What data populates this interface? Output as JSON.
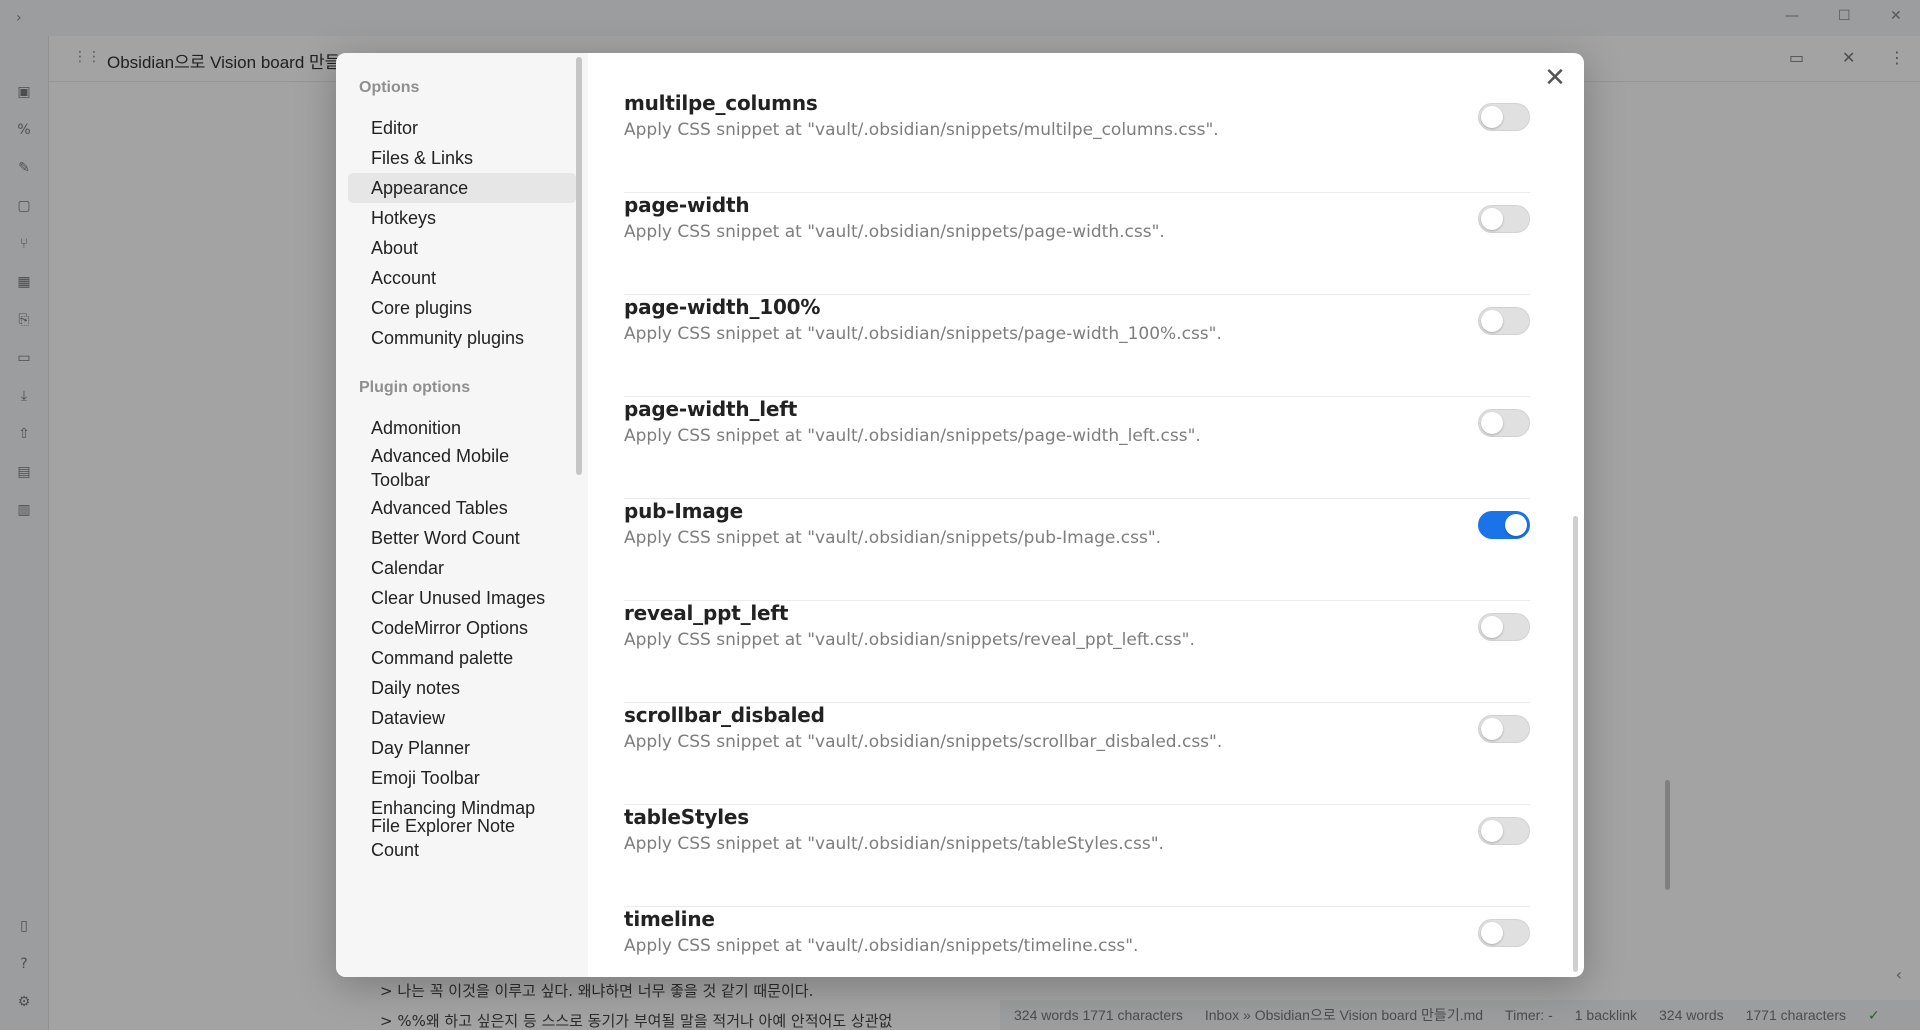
{
  "app": {
    "tab_title": "Obsidian으로 Vision board 만들기",
    "window_controls": [
      "minimize-icon",
      "maximize-icon",
      "close-icon"
    ],
    "editor_lines": [
      ">  나는 꼭 이것을 이루고 싶다. 왜냐하면 너무 좋을 것 같기 때문이다.",
      ">  %%왜 하고 싶은지 등 스스로 동기가 부여될 말을 적거나 아예 안적어도 상관없"
    ],
    "status": {
      "word_count": "324 words 1771 characters",
      "breadcrumb": "Inbox » Obsidian으로 Vision board 만들기.md",
      "timer": "Timer: -",
      "backlinks": "1 backlink",
      "words": "324 words",
      "characters": "1771 characters"
    }
  },
  "settings": {
    "close_label": "✕",
    "options_title": "Options",
    "options_items": [
      {
        "label": "Editor",
        "active": false
      },
      {
        "label": "Files & Links",
        "active": false
      },
      {
        "label": "Appearance",
        "active": true
      },
      {
        "label": "Hotkeys",
        "active": false
      },
      {
        "label": "About",
        "active": false
      },
      {
        "label": "Account",
        "active": false
      },
      {
        "label": "Core plugins",
        "active": false
      },
      {
        "label": "Community plugins",
        "active": false
      }
    ],
    "plugin_title": "Plugin options",
    "plugin_items": [
      "Admonition",
      "Advanced Mobile Toolbar",
      "Advanced Tables",
      "Better Word Count",
      "Calendar",
      "Clear Unused Images",
      "CodeMirror Options",
      "Command palette",
      "Daily notes",
      "Dataview",
      "Day Planner",
      "Emoji Toolbar",
      "Enhancing Mindmap",
      "File Explorer Note Count"
    ],
    "snippets": [
      {
        "name": "multilpe_columns",
        "desc": "Apply CSS snippet at \"vault/.obsidian/snippets/multilpe_columns.css\".",
        "enabled": false
      },
      {
        "name": "page-width",
        "desc": "Apply CSS snippet at \"vault/.obsidian/snippets/page-width.css\".",
        "enabled": false
      },
      {
        "name": "page-width_100%",
        "desc": "Apply CSS snippet at \"vault/.obsidian/snippets/page-width_100%.css\".",
        "enabled": false
      },
      {
        "name": "page-width_left",
        "desc": "Apply CSS snippet at \"vault/.obsidian/snippets/page-width_left.css\".",
        "enabled": false
      },
      {
        "name": "pub-Image",
        "desc": "Apply CSS snippet at \"vault/.obsidian/snippets/pub-Image.css\".",
        "enabled": true
      },
      {
        "name": "reveal_ppt_left",
        "desc": "Apply CSS snippet at \"vault/.obsidian/snippets/reveal_ppt_left.css\".",
        "enabled": false
      },
      {
        "name": "scrollbar_disbaled",
        "desc": "Apply CSS snippet at \"vault/.obsidian/snippets/scrollbar_disbaled.css\".",
        "enabled": false
      },
      {
        "name": "tableStyles",
        "desc": "Apply CSS snippet at \"vault/.obsidian/snippets/tableStyles.css\".",
        "enabled": false
      },
      {
        "name": "timeline",
        "desc": "Apply CSS snippet at \"vault/.obsidian/snippets/timeline.css\".",
        "enabled": false
      }
    ],
    "toggle_on_color": "#1a73e8"
  }
}
